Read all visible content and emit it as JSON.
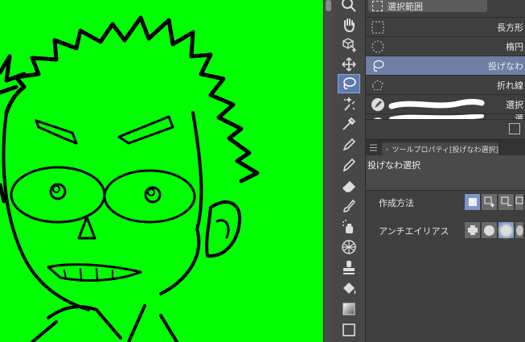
{
  "app": {
    "accent": "#6e7fa3",
    "canvas_color": "#00ff00"
  },
  "toolbox": {
    "tools": [
      {
        "name": "zoom-tool",
        "icon": "magnifier-icon"
      },
      {
        "name": "hand-tool",
        "icon": "hand-icon"
      },
      {
        "name": "object-tool",
        "icon": "cube-arrow-icon"
      },
      {
        "name": "move-tool",
        "icon": "move-arrows-icon"
      },
      {
        "name": "selection-tool",
        "icon": "lasso-icon",
        "active": true
      },
      {
        "name": "auto-select-tool",
        "icon": "magic-wand-icon"
      },
      {
        "name": "eyedropper-tool",
        "icon": "eyedropper-icon"
      },
      {
        "name": "pen-tool",
        "icon": "pen-icon"
      },
      {
        "name": "pencil-tool",
        "icon": "pencil-icon"
      },
      {
        "name": "eraser-tool",
        "icon": "eraser-icon"
      },
      {
        "name": "brush-tool",
        "icon": "brush-icon"
      },
      {
        "name": "airbrush-tool",
        "icon": "airbrush-icon"
      },
      {
        "name": "decoration-tool",
        "icon": "pattern-icon"
      },
      {
        "name": "stamp-tool",
        "icon": "stamp-icon"
      },
      {
        "name": "fill-tool",
        "icon": "bucket-icon"
      },
      {
        "name": "gradient-tool",
        "icon": "gradient-icon"
      },
      {
        "name": "figure-tool",
        "icon": "square-icon"
      }
    ]
  },
  "subtool": {
    "group_label": "選択範囲",
    "items": [
      {
        "label": "長方形",
        "icon": "rect-select-icon"
      },
      {
        "label": "楕円",
        "icon": "ellipse-select-icon"
      },
      {
        "label": "投げなわ",
        "icon": "lasso-select-icon",
        "selected": true
      },
      {
        "label": "折れ線",
        "icon": "polyline-select-icon"
      },
      {
        "label": "選択",
        "icon": "selection-pen-icon"
      },
      {
        "label": "選",
        "icon": "selection-eraser-icon"
      }
    ]
  },
  "tool_property": {
    "tab_label": "ツールプロパティ[投げなわ選択]",
    "subtool_name": "投げなわ選択",
    "rows": [
      {
        "label": "作成方法"
      },
      {
        "label": "アンチエイリアス"
      }
    ]
  }
}
